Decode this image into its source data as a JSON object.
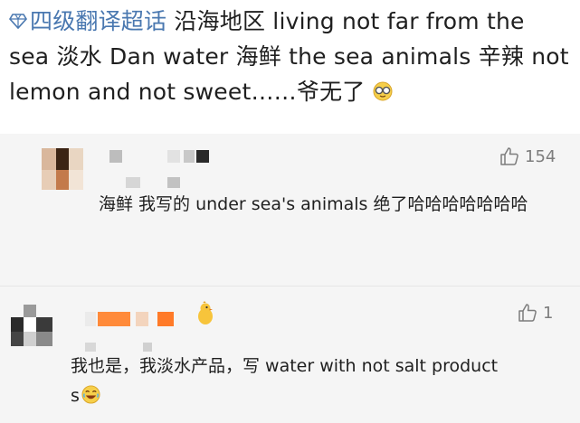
{
  "post": {
    "topic_label": "四级翻译超话",
    "body_text": "沿海地区  living not far from the sea  淡水  Dan water  海鲜  the sea animals 辛辣  not lemon and not sweet……爷无了",
    "icons": {
      "topic": "diamond-icon",
      "end_emoji": "glasses-emoji-icon"
    },
    "colors": {
      "topic": "#4a78b0"
    }
  },
  "comments": [
    {
      "text": "海鲜 我写的 under sea's animals  绝了哈哈哈哈哈哈哈",
      "like_count": "154",
      "like_icon": "thumbs-up-icon"
    },
    {
      "text": "我也是，我淡水产品，写 water with not salt products",
      "like_count": "1",
      "like_icon": "thumbs-up-icon",
      "end_emoji": "laughing-emoji-icon",
      "badge_icon": "chick-badge-icon"
    }
  ]
}
